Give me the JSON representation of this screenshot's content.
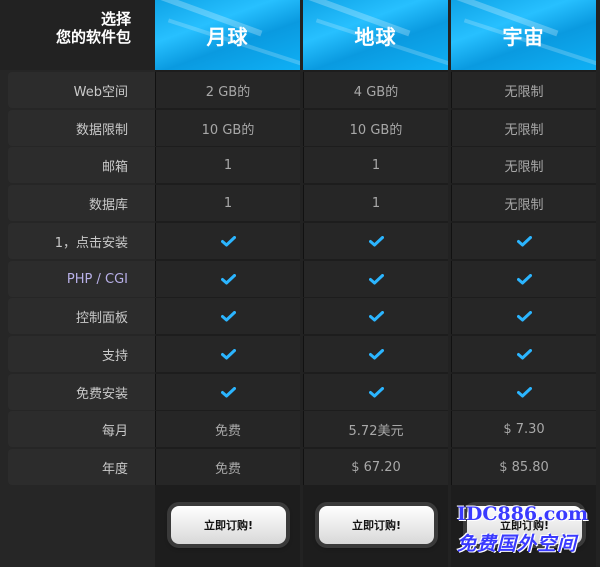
{
  "header": {
    "title_line1": "选择",
    "title_line2": "您的软件包"
  },
  "plans": [
    {
      "name": "月球"
    },
    {
      "name": "地球"
    },
    {
      "name": "宇宙"
    }
  ],
  "rows": [
    {
      "label": "Web空间",
      "values": [
        "2 GB的",
        "4 GB的",
        "无限制"
      ]
    },
    {
      "label": "数据限制",
      "values": [
        "10 GB的",
        "10 GB的",
        "无限制"
      ]
    },
    {
      "label": "邮箱",
      "values": [
        "1",
        "1",
        "无限制"
      ]
    },
    {
      "label": "数据库",
      "values": [
        "1",
        "1",
        "无限制"
      ]
    },
    {
      "label": "1，点击安装",
      "values": [
        "check",
        "check",
        "check"
      ]
    },
    {
      "label": "PHP / CGI",
      "values": [
        "check",
        "check",
        "check"
      ]
    },
    {
      "label": "控制面板",
      "values": [
        "check",
        "check",
        "check"
      ]
    },
    {
      "label": "支持",
      "values": [
        "check",
        "check",
        "check"
      ]
    },
    {
      "label": "免费安装",
      "values": [
        "check",
        "check",
        "check"
      ]
    },
    {
      "label": "每月",
      "values": [
        "免费",
        "5.72美元",
        "$ 7.30"
      ]
    },
    {
      "label": "年度",
      "values": [
        "免费",
        "$ 67.20",
        "$ 85.80"
      ]
    }
  ],
  "order_button_label": "立即订购!",
  "watermark": {
    "line1": "IDC886.com",
    "line2": "免费国外空间"
  },
  "colors": {
    "accent": "#0fa3e6",
    "check": "#2bb5ff"
  }
}
